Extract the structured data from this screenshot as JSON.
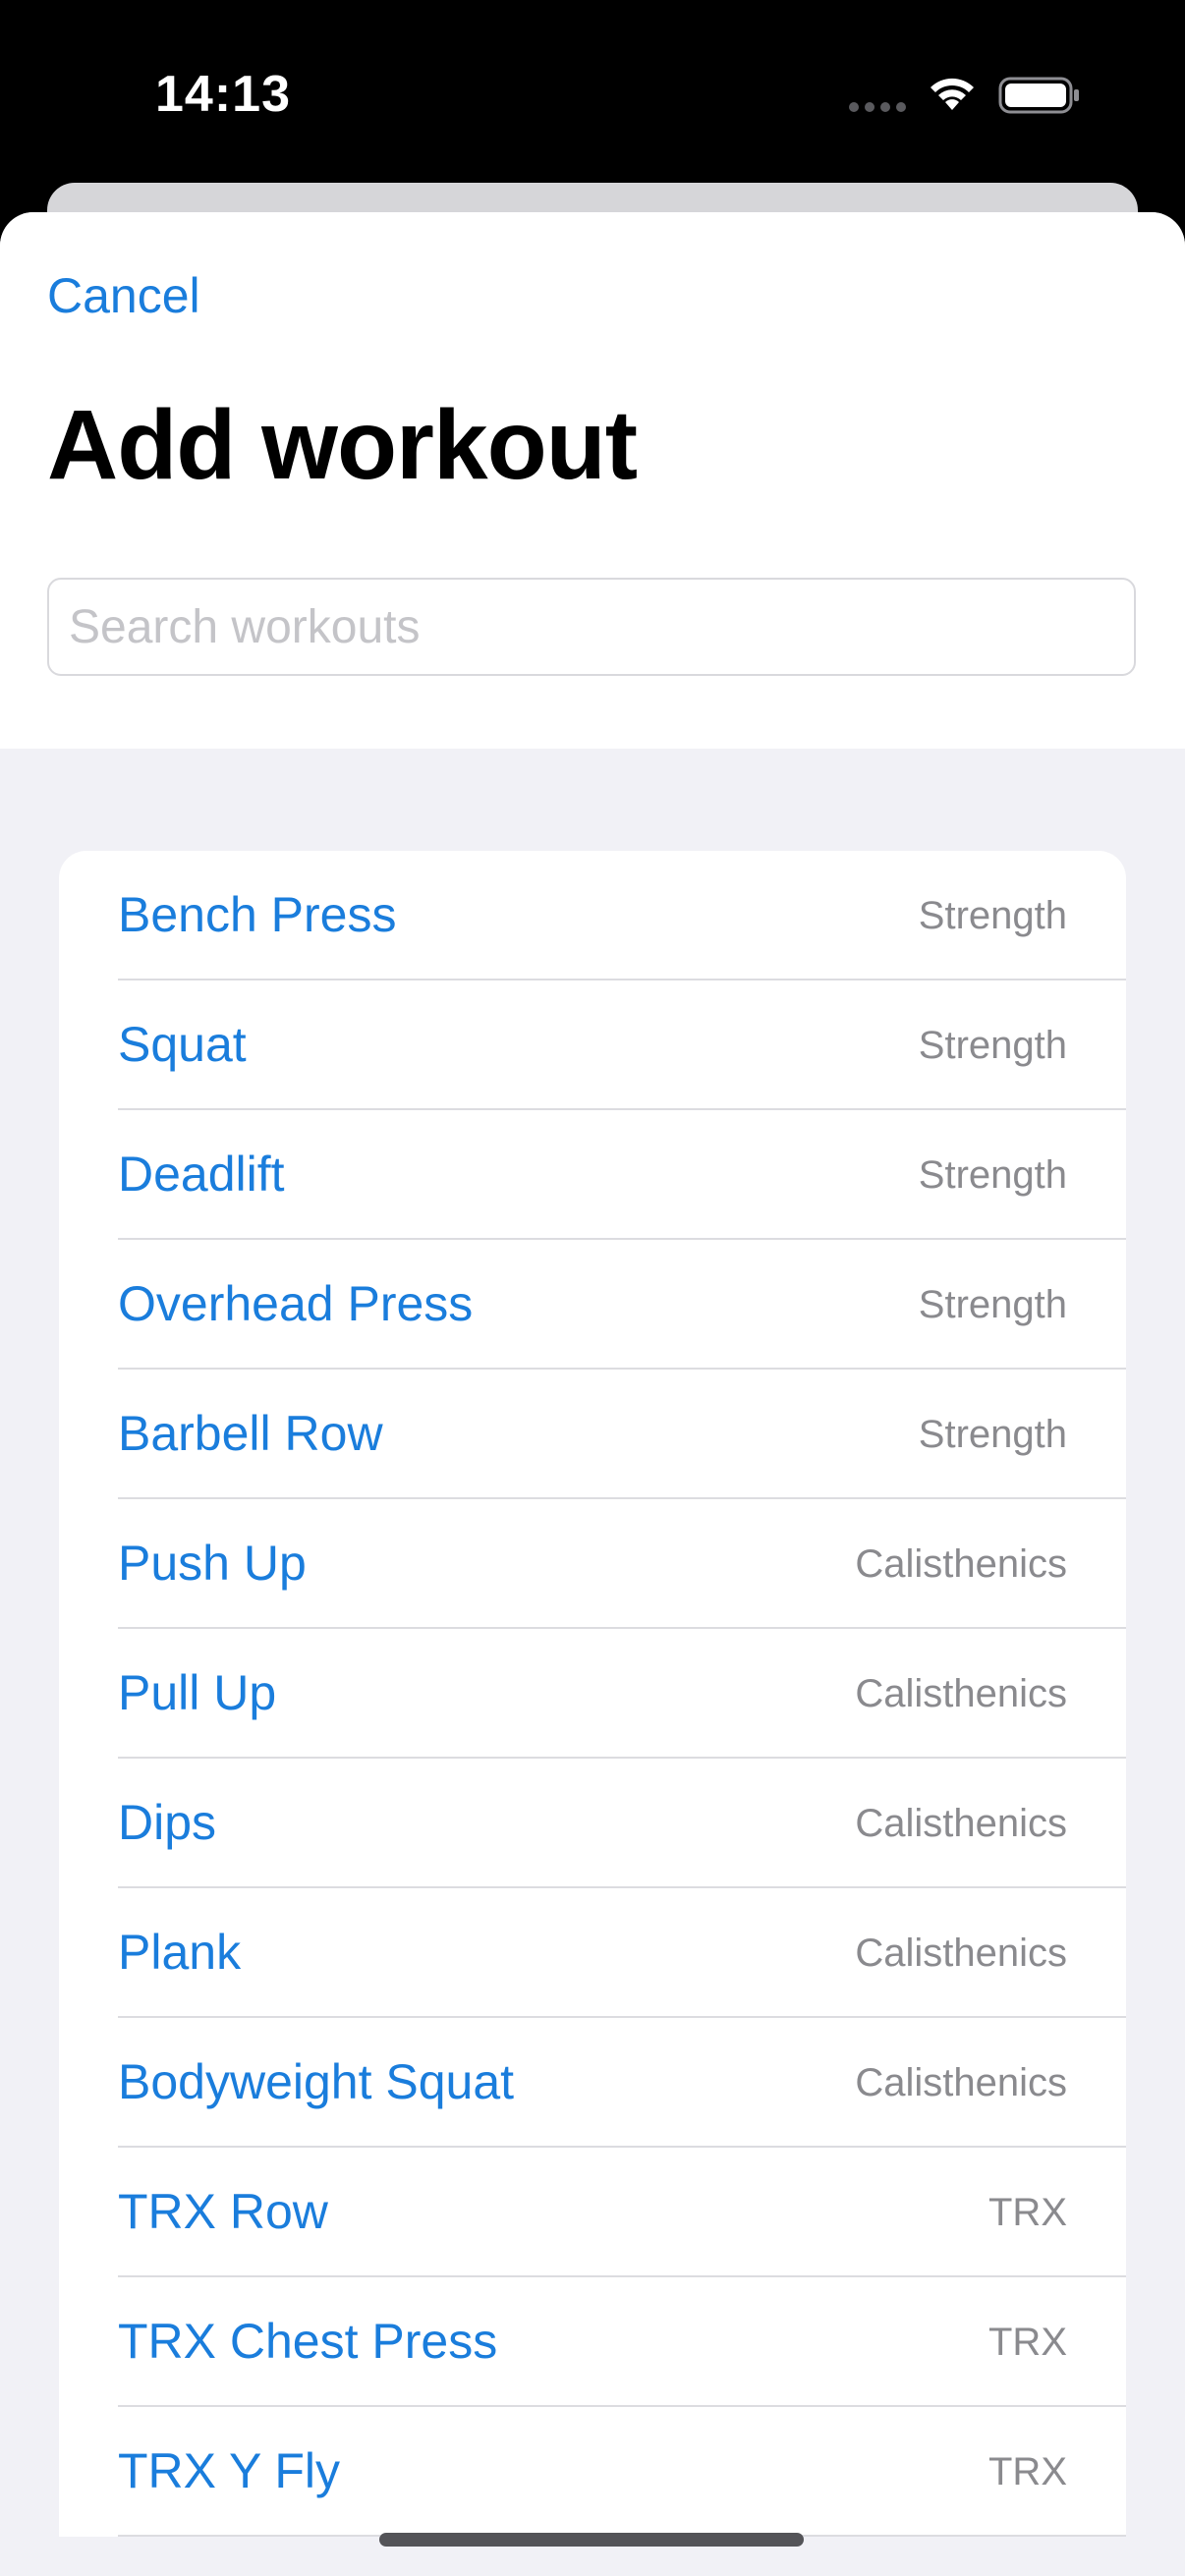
{
  "status_bar": {
    "time": "14:13",
    "wifi_icon": "wifi-icon",
    "battery_icon": "battery-icon"
  },
  "header": {
    "cancel_label": "Cancel",
    "title": "Add workout"
  },
  "search": {
    "placeholder": "Search workouts",
    "value": ""
  },
  "workouts": [
    {
      "name": "Bench Press",
      "category": "Strength"
    },
    {
      "name": "Squat",
      "category": "Strength"
    },
    {
      "name": "Deadlift",
      "category": "Strength"
    },
    {
      "name": "Overhead Press",
      "category": "Strength"
    },
    {
      "name": "Barbell Row",
      "category": "Strength"
    },
    {
      "name": "Push Up",
      "category": "Calisthenics"
    },
    {
      "name": "Pull Up",
      "category": "Calisthenics"
    },
    {
      "name": "Dips",
      "category": "Calisthenics"
    },
    {
      "name": "Plank",
      "category": "Calisthenics"
    },
    {
      "name": "Bodyweight Squat",
      "category": "Calisthenics"
    },
    {
      "name": "TRX Row",
      "category": "TRX"
    },
    {
      "name": "TRX Chest Press",
      "category": "TRX"
    },
    {
      "name": "TRX Y Fly",
      "category": "TRX"
    }
  ],
  "colors": {
    "accent": "#1a7ddc",
    "secondary_text": "#8a8a8e",
    "grouped_background": "#f1f1f6"
  }
}
